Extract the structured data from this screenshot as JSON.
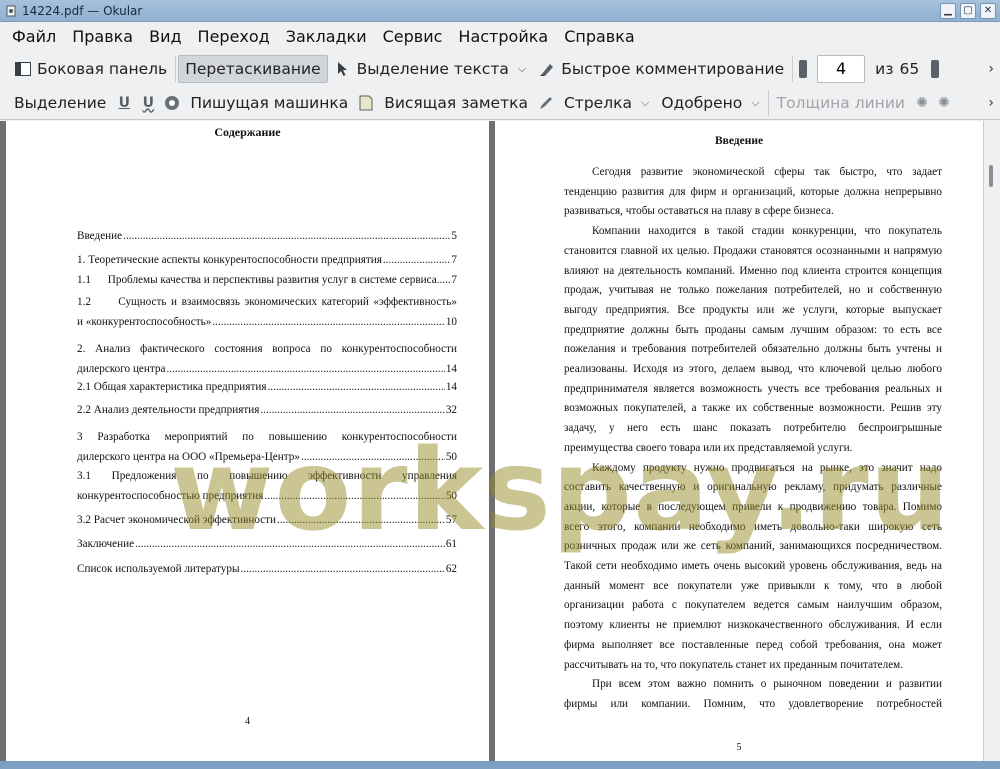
{
  "window": {
    "title": "14224.pdf  — Okular"
  },
  "menu": [
    "Файл",
    "Правка",
    "Вид",
    "Переход",
    "Закладки",
    "Сервис",
    "Настройка",
    "Справка"
  ],
  "toolbar1": {
    "sidebar": "Боковая панель",
    "browse": "Перетаскивание",
    "text_select": "Выделение текста",
    "quick_annot": "Быстрое комментирование",
    "page_current": "4",
    "page_of": "из",
    "page_total": "65"
  },
  "toolbar2": {
    "selection": "Выделение",
    "typewriter": "Пишущая машинка",
    "inline_note": "Висящая заметка",
    "arrow": "Стрелка",
    "approved": "Одобрено",
    "line_width": "Толщина линии"
  },
  "left_page": {
    "title": "Содержание",
    "number": "4",
    "toc": [
      {
        "label": "Введение",
        "page": "5"
      },
      {
        "label": "1. Теоретические аспекты конкурентоспособности предприятия",
        "page": "7"
      },
      {
        "label": "1.1      Проблемы качества и перспективы развития услуг в системе сервиса",
        "page": "7"
      },
      {
        "line1": "1.2      Сущность и взаимосвязь экономических категорий «эффективность»",
        "label": "и «конкурентоспособность»",
        "page": "10"
      },
      {
        "line1": "2.  Анализ  фактического  состояния  вопроса  по  конкурентоспособности",
        "label": "дилерского центра",
        "page": "14"
      },
      {
        "label": "2.1 Общая характеристика предприятия",
        "page": "14"
      },
      {
        "label": "2.2 Анализ деятельности предприятия",
        "page": "32"
      },
      {
        "line1": "3   Разработка   мероприятий   по   повышению   конкурентоспособности",
        "label": "дилерского центра на ООО «Премьера-Центр»",
        "page": "50"
      },
      {
        "line1": "3.1      Предложения      по      повышению      эффективности      управления",
        "label": "конкурентоспособностью предприятия",
        "page": "50"
      },
      {
        "label": "3.2 Расчет экономической эффективности",
        "page": "57"
      },
      {
        "label": "Заключение",
        "page": "61"
      },
      {
        "label": "Список используемой литературы",
        "page": "62"
      }
    ]
  },
  "right_page": {
    "title": "Введение",
    "number": "5",
    "lines": [
      {
        "t": "Сегодня развитие экономической сферы так быстро, что задает",
        "indent": true
      },
      {
        "t": "тенденцию развития для фирм и организаций, которые должна непрерывно"
      },
      {
        "t": "развиваться, чтобы оставаться на плаву в сфере бизнеса.",
        "last": true
      },
      {
        "t": "Компании находится в такой стадии конкуренции, что покупатель",
        "indent": true
      },
      {
        "t": "становится главной их целью. Продажи становятся осознанными и напрямую"
      },
      {
        "t": "влияют на деятельность компаний. Именно под клиента строится концепция"
      },
      {
        "t": "продаж, учитывая не только пожелания потребителей, но и собственную"
      },
      {
        "t": "выгоду предприятия. Все продукты или же услуги, которые выпускает"
      },
      {
        "t": "предприятие должны быть проданы самым лучшим образом: то есть все"
      },
      {
        "t": "пожелания и требования потребителей обязательно должны быть учтены и"
      },
      {
        "t": "реализованы. Исходя из этого, делаем вывод, что ключевой целью любого"
      },
      {
        "t": "предпринимателя является возможность учесть все требования реальных и"
      },
      {
        "t": "возможных покупателей, а также их собственные возможности. Решив эту"
      },
      {
        "t": "задачу, у него есть шанс показать потребителю беспроигрышные"
      },
      {
        "t": "преимущества своего товара или их представляемой услуги.",
        "last": true
      },
      {
        "t": "Каждому продукту нужно продвигаться на рынке, это значит надо",
        "indent": true
      },
      {
        "t": "составить качественную и оригинальную рекламу, придумать различные"
      },
      {
        "t": "акции, которые в последующем привели к продвижению товара. Помимо"
      },
      {
        "t": "всего этого, компании необходимо иметь довольно-таки широкую сеть"
      },
      {
        "t": "розничных продаж или же сеть компаний, занимающихся посредничеством."
      },
      {
        "t": "Такой сети необходимо иметь очень высокий уровень обслуживания, ведь на"
      },
      {
        "t": "данный момент все покупатели уже привыкли к тому, что в любой"
      },
      {
        "t": "организации работа с покупателем ведется самым наилучшим образом,"
      },
      {
        "t": "поэтому клиенты не приемлют низкокачественного обслуживания. И если"
      },
      {
        "t": "фирма выполняет все поставленные перед собой требования, она может"
      },
      {
        "t": "рассчитывать на то, что покупатель станет их преданным почитателем.",
        "last": true
      },
      {
        "t": "При всем этом важно помнить о рыночном поведении и развитии",
        "indent": true
      },
      {
        "t": "фирмы    или    компании.    Помним,    что    удовлетворение    потребностей"
      }
    ]
  },
  "watermark": "workspay.ru"
}
